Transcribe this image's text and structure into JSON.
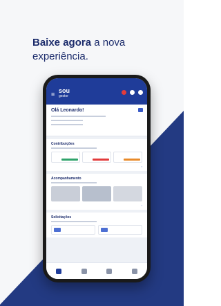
{
  "headline": {
    "bold": "Baixe agora",
    "rest1": " a nova",
    "rest2": "experiência."
  },
  "app": {
    "logo_top": "sou",
    "logo_bottom": "gestor",
    "greeting": "Olá Leonardo!",
    "section_contributions": "Contribuições",
    "section_accompaniment": "Acompanhamento",
    "section_requests": "Solicitações"
  },
  "colors": {
    "navy": "#233a82",
    "appbar": "#1f3c99",
    "headline": "#1b2b6b",
    "green": "#2fa36b",
    "red": "#e23b3b",
    "orange": "#e88a2a"
  },
  "icons": {
    "menu": "menu-icon",
    "notification": "bell-icon",
    "settings": "gear-icon",
    "logout": "logout-icon"
  }
}
